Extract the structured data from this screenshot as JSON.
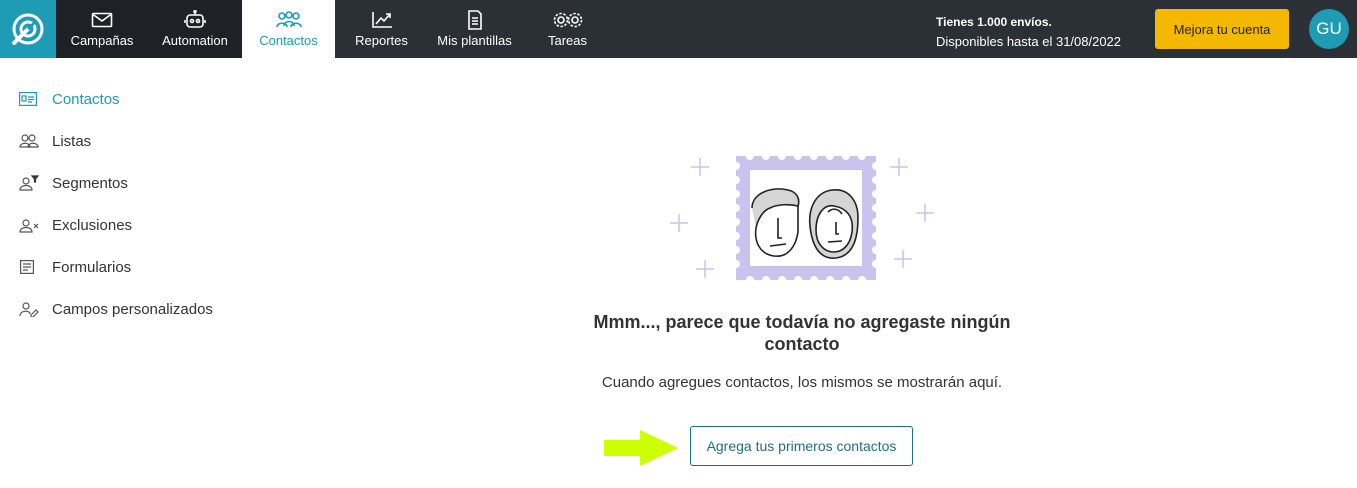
{
  "nav": {
    "items": [
      {
        "label": "Campañas",
        "icon": "envelope-icon"
      },
      {
        "label": "Automation",
        "icon": "robot-icon"
      },
      {
        "label": "Contactos",
        "icon": "contacts-group-icon"
      },
      {
        "label": "Reportes",
        "icon": "chart-trend-icon"
      },
      {
        "label": "Mis plantillas",
        "icon": "document-icon"
      },
      {
        "label": "Tareas",
        "icon": "gears-icon"
      }
    ],
    "active": "Contactos"
  },
  "account": {
    "line1": "Tienes 1.000 envíos.",
    "line2": "Disponibles hasta el 31/08/2022",
    "upgrade_label": "Mejora tu cuenta",
    "avatar_initials": "GU"
  },
  "sidebar": {
    "items": [
      {
        "label": "Contactos",
        "icon": "contact-card-icon"
      },
      {
        "label": "Listas",
        "icon": "users-icon"
      },
      {
        "label": "Segmentos",
        "icon": "user-filter-icon"
      },
      {
        "label": "Exclusiones",
        "icon": "user-exclude-icon"
      },
      {
        "label": "Formularios",
        "icon": "form-icon"
      },
      {
        "label": "Campos personalizados",
        "icon": "user-edit-icon"
      }
    ]
  },
  "empty": {
    "title_line1": "Mmm..., parece que todavía no agregaste ningún",
    "title_line2": "contacto",
    "subtitle": "Cuando agregues contactos, los mismos se mostrarán aquí.",
    "cta_label": "Agrega tus primeros contactos"
  },
  "colors": {
    "topbar": "#2b2f36",
    "brand": "#1e9bb5",
    "upgrade": "#f5b800",
    "stamp": "#c9c3ee",
    "arrow": "#ccff00"
  }
}
